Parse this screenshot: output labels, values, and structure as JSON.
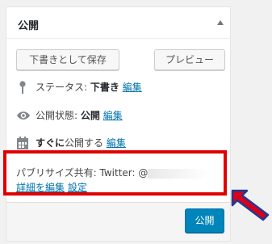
{
  "header": {
    "title": "公開"
  },
  "buttons": {
    "save_draft": "下書きとして保存",
    "preview": "プレビュー",
    "publish": "公開"
  },
  "status": {
    "label": "ステータス:",
    "value": "下書き",
    "edit": "編集"
  },
  "visibility": {
    "label": "公開状態:",
    "value": "公開",
    "edit": "編集"
  },
  "schedule": {
    "emphasis": "すぐに",
    "label": "公開する",
    "edit": "編集"
  },
  "publicize": {
    "label": "パブリサイズ共有:",
    "service": "Twitter:",
    "handle_prefix": "@",
    "edit_details": "詳細を編集",
    "settings": "設定"
  },
  "colors": {
    "highlight": "#e00000",
    "arrow": "#d9001b",
    "arrow_outline": "#1f3a93",
    "primary": "#0085ba",
    "link": "#0073aa"
  },
  "icons": [
    "pin-icon",
    "eye-icon",
    "calendar-icon",
    "collapse-arrow-icon"
  ]
}
